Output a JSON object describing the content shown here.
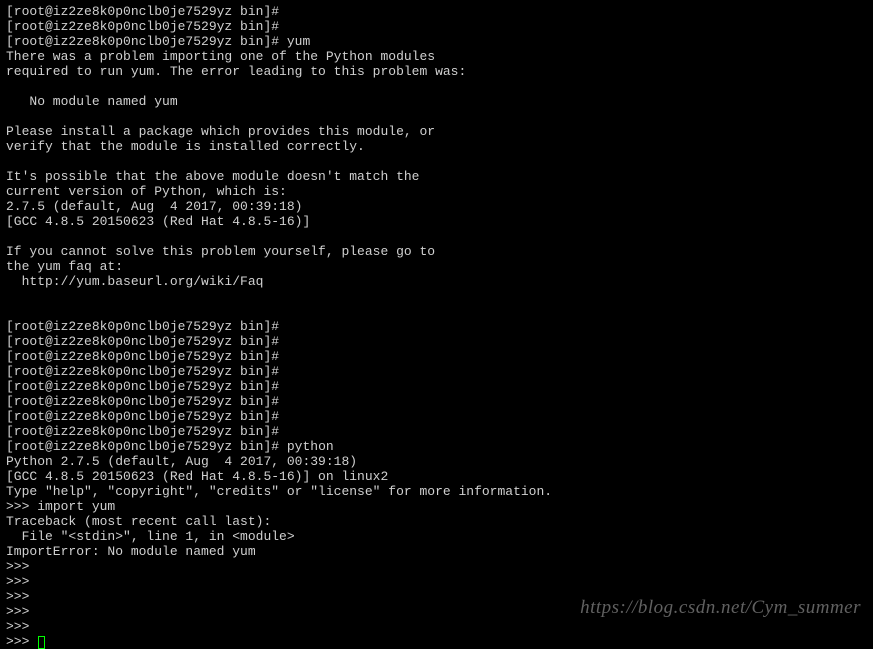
{
  "prompt_base": "[root@iz2ze8k0p0nclb0je7529yz bin]#",
  "cmd_yum": "yum",
  "cmd_python": "python",
  "yum_out": {
    "l1": "There was a problem importing one of the Python modules",
    "l2": "required to run yum. The error leading to this problem was:",
    "l3": "   No module named yum",
    "l4": "Please install a package which provides this module, or",
    "l5": "verify that the module is installed correctly.",
    "l6": "It's possible that the above module doesn't match the",
    "l7": "current version of Python, which is:",
    "l8": "2.7.5 (default, Aug  4 2017, 00:39:18)",
    "l9": "[GCC 4.8.5 20150623 (Red Hat 4.8.5-16)]",
    "l10": "If you cannot solve this problem yourself, please go to",
    "l11": "the yum faq at:",
    "l12": "  http://yum.baseurl.org/wiki/Faq"
  },
  "py_out": {
    "l1": "Python 2.7.5 (default, Aug  4 2017, 00:39:18)",
    "l2": "[GCC 4.8.5 20150623 (Red Hat 4.8.5-16)] on linux2",
    "l3": "Type \"help\", \"copyright\", \"credits\" or \"license\" for more information."
  },
  "repl_prompt": ">>>",
  "py_cmd": "import yum",
  "trace": {
    "l1": "Traceback (most recent call last):",
    "l2": "  File \"<stdin>\", line 1, in <module>",
    "l3": "ImportError: No module named yum"
  },
  "watermark": "https://blog.csdn.net/Cym_summer"
}
